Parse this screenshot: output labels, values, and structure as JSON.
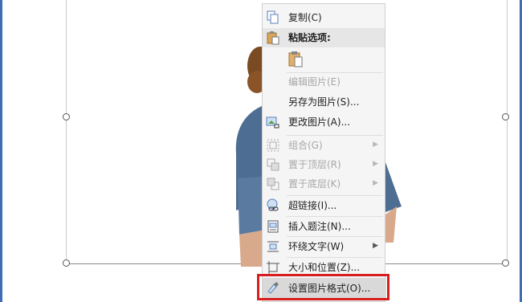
{
  "menu": {
    "copy": "复制(C)",
    "paste_options": "粘贴选项:",
    "edit_picture": "编辑图片(E)",
    "save_as_picture": "另存为图片(S)...",
    "change_picture": "更改图片(A)...",
    "group": "组合(G)",
    "bring_to_front": "置于顶层(R)",
    "send_to_back": "置于底层(K)",
    "hyperlink": "超链接(I)...",
    "insert_caption": "插入题注(N)...",
    "wrap_text": "环绕文字(W)",
    "size_position": "大小和位置(Z)...",
    "format_picture": "设置图片格式(O)..."
  },
  "colors": {
    "highlight_box": "#d81e1e",
    "frame": "#3f6db3",
    "menu_bg": "#f5f5f5"
  },
  "icons": [
    "copy-icon",
    "paste-icon",
    "paste-keep-formatting-icon",
    "save-picture-icon",
    "change-picture-icon",
    "group-icon",
    "bring-front-icon",
    "send-back-icon",
    "hyperlink-icon",
    "caption-icon",
    "wrap-text-icon",
    "size-position-icon",
    "format-picture-icon",
    "submenu-arrow-icon"
  ]
}
